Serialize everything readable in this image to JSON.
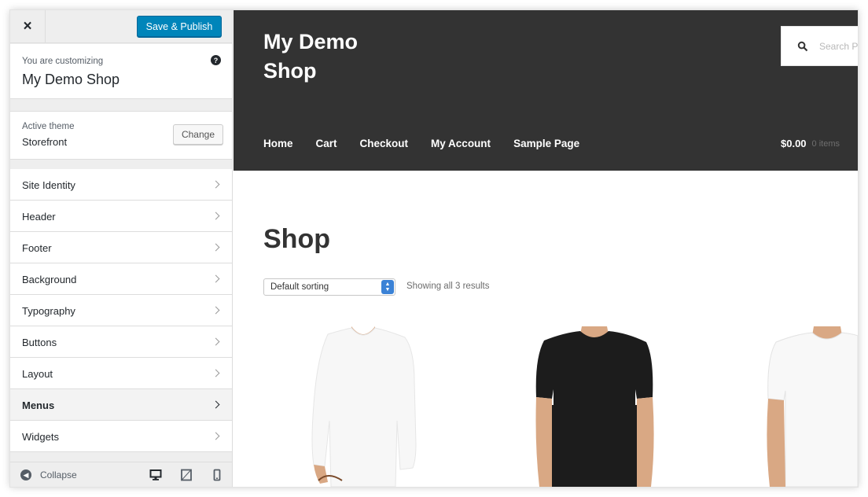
{
  "sidebar": {
    "close_glyph": "×",
    "publish_label": "Save & Publish",
    "customizing_label": "You are customizing",
    "site_name": "My Demo Shop",
    "help_glyph": "?",
    "theme_label": "Active theme",
    "theme_name": "Storefront",
    "change_label": "Change",
    "panels": [
      {
        "label": "Site Identity",
        "active": false
      },
      {
        "label": "Header",
        "active": false
      },
      {
        "label": "Footer",
        "active": false
      },
      {
        "label": "Background",
        "active": false
      },
      {
        "label": "Typography",
        "active": false
      },
      {
        "label": "Buttons",
        "active": false
      },
      {
        "label": "Layout",
        "active": false
      },
      {
        "label": "Menus",
        "active": true
      },
      {
        "label": "Widgets",
        "active": false
      }
    ],
    "collapse_label": "Collapse",
    "devices": [
      "desktop-icon",
      "tablet-icon",
      "mobile-icon"
    ]
  },
  "preview": {
    "site_title": "My Demo Shop",
    "search_placeholder": "Search P",
    "nav": [
      "Home",
      "Cart",
      "Checkout",
      "My Account",
      "Sample Page"
    ],
    "cart_total": "$0.00",
    "cart_items": "0 items",
    "heading": "Shop",
    "sort_value": "Default sorting",
    "result_count": "Showing all 3 results",
    "products": [
      {
        "name": "white-long-sleeve-shirt-product"
      },
      {
        "name": "black-t-shirt-product"
      },
      {
        "name": "white-t-shirt-product"
      }
    ]
  },
  "colors": {
    "publish": "#0085ba",
    "header_bg": "#333333",
    "sidebar_bg": "#eeeeee"
  }
}
